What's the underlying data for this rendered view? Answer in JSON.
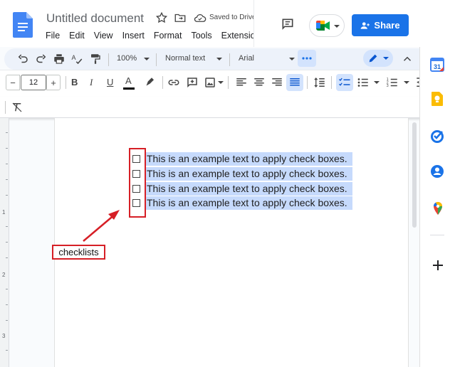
{
  "header": {
    "title": "Untitled document",
    "saved_status": "Saved to Drive",
    "share_label": "Share",
    "menu": [
      "File",
      "Edit",
      "View",
      "Insert",
      "Format",
      "Tools",
      "Extensions"
    ]
  },
  "toolbar": {
    "zoom": "100%",
    "style": "Normal text",
    "font": "Arial",
    "font_size": "12",
    "decrease_label": "−",
    "increase_label": "+",
    "bold": "B",
    "italic": "I",
    "underline": "U",
    "text_color": "A"
  },
  "document": {
    "checklist_items": [
      "This is an example text to apply check boxes.",
      "This is an example text to apply check boxes.",
      "This is an example text to apply check boxes.",
      "This is an example text to apply check boxes."
    ]
  },
  "annotation": {
    "label": "checklists",
    "color": "#d61f26"
  },
  "ruler": {
    "numbers": [
      "1",
      "2",
      "3"
    ]
  },
  "colors": {
    "accent": "#1a73e8",
    "selection": "#c6dafc",
    "toolbar_bg": "#edf2fa"
  }
}
